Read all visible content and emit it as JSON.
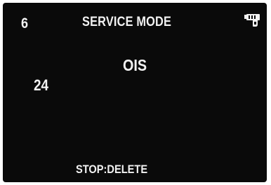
{
  "screen": {
    "corner_number": "6",
    "title": "SERVICE MODE",
    "item_label": "OIS",
    "item_value": "24",
    "hint": "STOP:DELETE",
    "battery_icon": "battery-icon"
  },
  "colors": {
    "background": "#0a0a0a",
    "text": "#f2f2f2"
  }
}
